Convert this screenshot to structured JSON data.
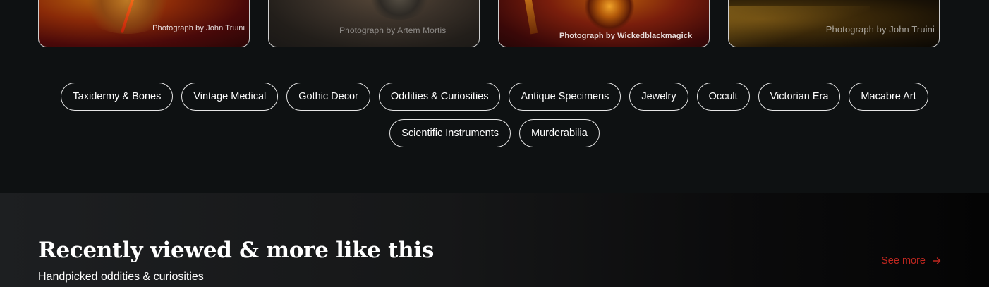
{
  "cards": [
    {
      "credit": "Photograph by John Truini"
    },
    {
      "credit": "Photograph by Artem Mortis"
    },
    {
      "credit": "Photograph by Wickedblackmagick"
    },
    {
      "credit": "Photograph by John Truini"
    }
  ],
  "tags": [
    "Taxidermy & Bones",
    "Vintage Medical",
    "Gothic Decor",
    "Oddities & Curiosities",
    "Antique Specimens",
    "Jewelry",
    "Occult",
    "Victorian Era",
    "Macabre Art",
    "Scientific Instruments",
    "Murderabilia"
  ],
  "section": {
    "title": "Recently viewed & more like this",
    "subtitle": "Handpicked oddities & curiosities",
    "see_more_label": "See more",
    "see_more_icon": "arrow-right-icon"
  },
  "colors": {
    "background": "#0e1112",
    "accent": "#c0271f",
    "pill_border": "#e6e6e6"
  }
}
